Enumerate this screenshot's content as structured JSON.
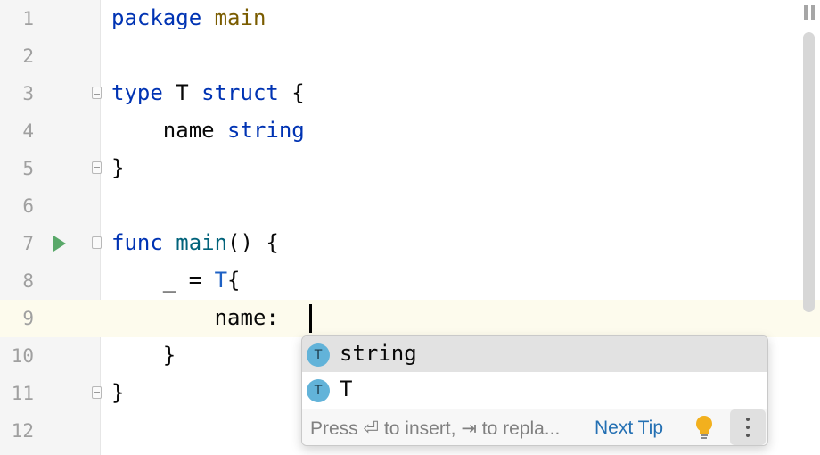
{
  "editor": {
    "lines": [
      {
        "n": "1",
        "tokens": [
          [
            "package",
            "kw"
          ],
          [
            " ",
            ""
          ],
          [
            "main",
            "pkg"
          ]
        ]
      },
      {
        "n": "2",
        "tokens": []
      },
      {
        "n": "3",
        "tokens": [
          [
            "type",
            "kw"
          ],
          [
            " T ",
            ""
          ],
          [
            "struct",
            "kw"
          ],
          [
            " {",
            ""
          ]
        ]
      },
      {
        "n": "4",
        "tokens": [
          [
            "    name ",
            ""
          ],
          [
            "string",
            "kw"
          ]
        ]
      },
      {
        "n": "5",
        "tokens": [
          [
            "}",
            ""
          ]
        ]
      },
      {
        "n": "6",
        "tokens": []
      },
      {
        "n": "7",
        "tokens": [
          [
            "func",
            "kw"
          ],
          [
            " ",
            ""
          ],
          [
            "main",
            "fn"
          ],
          [
            "() {",
            ""
          ]
        ]
      },
      {
        "n": "8",
        "tokens": [
          [
            "    _ = ",
            ""
          ],
          [
            "T",
            "tp"
          ],
          [
            "{",
            ""
          ]
        ]
      },
      {
        "n": "9",
        "tokens": [
          [
            "        name: ",
            ""
          ]
        ]
      },
      {
        "n": "10",
        "tokens": [
          [
            "    }",
            ""
          ]
        ]
      },
      {
        "n": "11",
        "tokens": [
          [
            "}",
            ""
          ]
        ]
      },
      {
        "n": "12",
        "tokens": []
      }
    ],
    "current_line": "9"
  },
  "completion": {
    "items": [
      {
        "icon": "T",
        "label": "string",
        "selected": true
      },
      {
        "icon": "T",
        "label": "T",
        "selected": false
      }
    ],
    "footer_text": "Press ⏎ to insert, ⇥ to repla...",
    "next_tip": "Next Tip"
  },
  "colors": {
    "keyword": "#0033b3",
    "package": "#7a5c00",
    "function": "#00627a",
    "type": "#1e61c4",
    "run_icon": "#59a869",
    "current_line_bg": "#fdfbed"
  }
}
